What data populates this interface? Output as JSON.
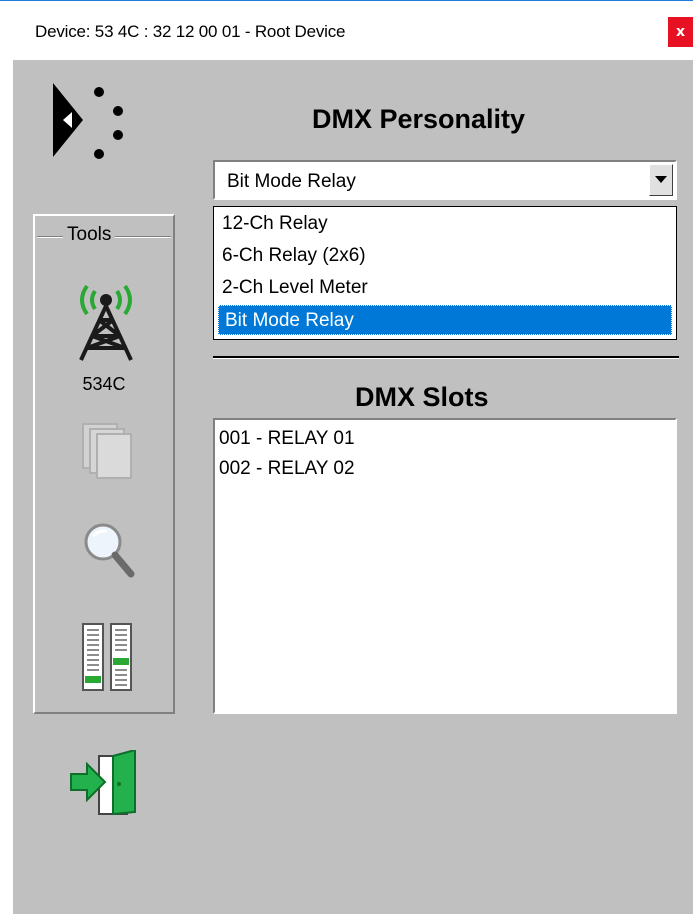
{
  "window": {
    "title": "Device:  53 4C : 32 12 00 01 - Root Device",
    "close_glyph": "x"
  },
  "tools": {
    "legend": "Tools",
    "device_label": "534C",
    "icons": [
      "antenna-tower-icon",
      "documents-icon",
      "magnifier-icon",
      "fader-mixer-icon"
    ]
  },
  "exit": {
    "icon": "exit-door-icon"
  },
  "personality": {
    "title": "DMX Personality",
    "selected": "Bit Mode Relay",
    "options": [
      "12-Ch Relay",
      "6-Ch Relay (2x6)",
      "2-Ch Level Meter",
      "Bit Mode Relay"
    ],
    "selected_index": 3
  },
  "slots": {
    "title": "DMX Slots",
    "items": [
      "001 - RELAY 01",
      "002 - RELAY 02"
    ]
  },
  "colors": {
    "panel": "#c0c0c0",
    "highlight": "#0078d7",
    "close": "#e81123",
    "antenna_green": "#2aa834",
    "exit_green": "#22b14c"
  }
}
